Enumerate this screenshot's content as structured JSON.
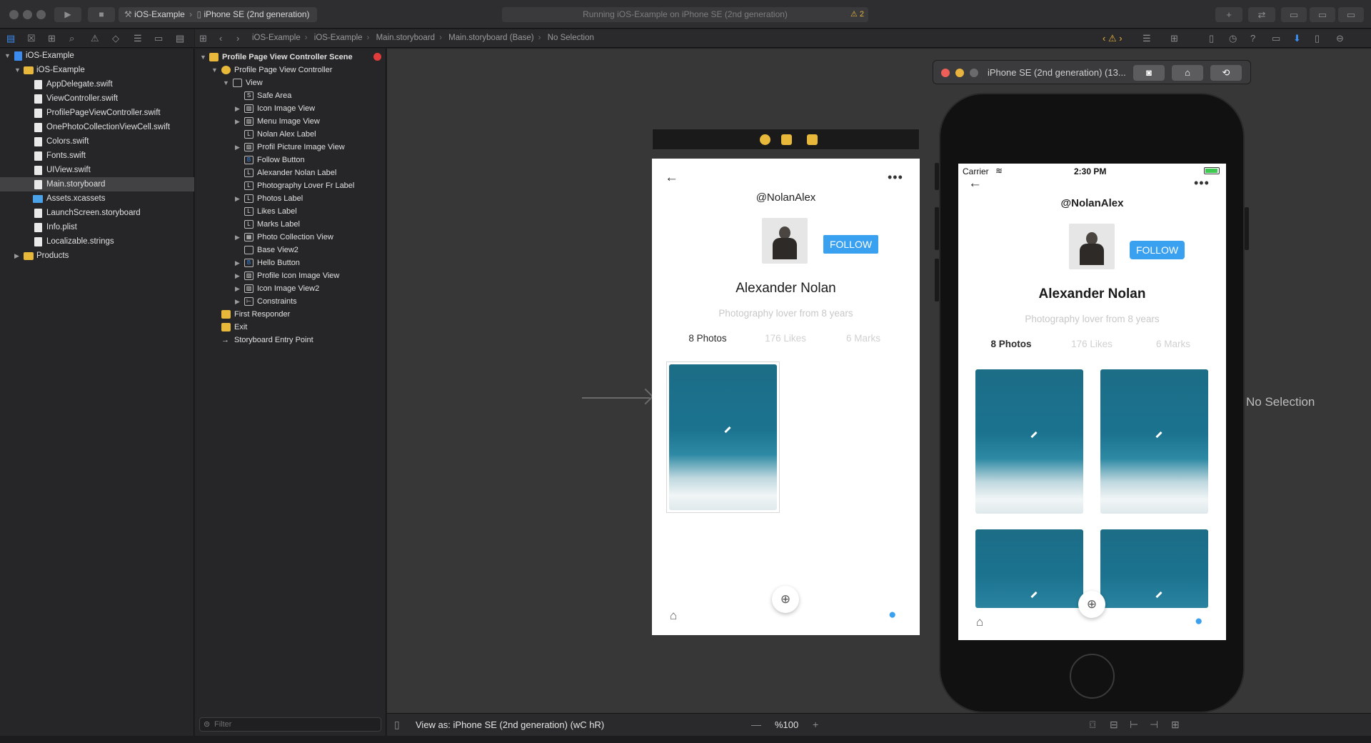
{
  "toolbar": {
    "scheme_target": "iOS-Example",
    "scheme_device": "iPhone SE (2nd generation)",
    "activity_text": "Running iOS-Example on iPhone SE (2nd generation)",
    "warning_count": "2",
    "add_glyph": "+",
    "swap_glyph": "⇄"
  },
  "navigator": {
    "items": [
      {
        "label": "iOS-Example",
        "kind": "project"
      },
      {
        "label": "iOS-Example",
        "kind": "folder"
      },
      {
        "label": "AppDelegate.swift",
        "kind": "file"
      },
      {
        "label": "ViewController.swift",
        "kind": "file"
      },
      {
        "label": "ProfilePageViewController.swift",
        "kind": "file"
      },
      {
        "label": "OnePhotoCollectionViewCell.swift",
        "kind": "file"
      },
      {
        "label": "Colors.swift",
        "kind": "file"
      },
      {
        "label": "Fonts.swift",
        "kind": "file"
      },
      {
        "label": "UIView.swift",
        "kind": "file"
      },
      {
        "label": "Main.storyboard",
        "kind": "file",
        "selected": true
      },
      {
        "label": "Assets.xcassets",
        "kind": "assets"
      },
      {
        "label": "LaunchScreen.storyboard",
        "kind": "file"
      },
      {
        "label": "Info.plist",
        "kind": "file"
      },
      {
        "label": "Localizable.strings",
        "kind": "file"
      },
      {
        "label": "Products",
        "kind": "folder"
      }
    ]
  },
  "jumpbar": {
    "crumbs": [
      "iOS-Example",
      "iOS-Example",
      "Main.storyboard",
      "Main.storyboard (Base)",
      "No Selection"
    ]
  },
  "outline": {
    "items": [
      {
        "label": "Profile Page View Controller Scene",
        "icon": "scene"
      },
      {
        "label": "Profile Page View Controller",
        "icon": "vc"
      },
      {
        "label": "View",
        "icon": "view"
      },
      {
        "label": "Safe Area",
        "icon": "S"
      },
      {
        "label": "Icon Image View",
        "icon": "img"
      },
      {
        "label": "Menu Image View",
        "icon": "img"
      },
      {
        "label": "Nolan Alex Label",
        "icon": "L"
      },
      {
        "label": "Profil Picture Image View",
        "icon": "img"
      },
      {
        "label": "Follow Button",
        "icon": "B"
      },
      {
        "label": "Alexander Nolan Label",
        "icon": "L"
      },
      {
        "label": "Photography Lover Fr Label",
        "icon": "L"
      },
      {
        "label": "Photos Label",
        "icon": "L"
      },
      {
        "label": "Likes Label",
        "icon": "L"
      },
      {
        "label": "Marks Label",
        "icon": "L"
      },
      {
        "label": "Photo Collection View",
        "icon": "grid"
      },
      {
        "label": "Base View2",
        "icon": "view"
      },
      {
        "label": "Hello Button",
        "icon": "B"
      },
      {
        "label": "Profile Icon Image View",
        "icon": "img"
      },
      {
        "label": "Icon Image View2",
        "icon": "img"
      },
      {
        "label": "Constraints",
        "icon": "c"
      },
      {
        "label": "First Responder",
        "icon": "fr"
      },
      {
        "label": "Exit",
        "icon": "exit"
      },
      {
        "label": "Storyboard Entry Point",
        "icon": "arrow"
      }
    ],
    "filter_placeholder": "Filter"
  },
  "profile": {
    "handle": "@NolanAlex",
    "follow_label": "FOLLOW",
    "name": "Alexander Nolan",
    "bio": "Photography lover from 8 years",
    "photos": "8 Photos",
    "likes": "176 Likes",
    "marks": "6 Marks",
    "back_glyph": "←",
    "more_glyph": "•••",
    "add_glyph": "⊕",
    "home_glyph": "⌂"
  },
  "simulator": {
    "title": "iPhone SE (2nd generation) (13...",
    "carrier": "Carrier",
    "time": "2:30 PM"
  },
  "inspector": {
    "no_selection": "No Selection"
  },
  "bottombar": {
    "view_as": "View as: iPhone SE (2nd generation) (wC hR)",
    "zoom": "%100",
    "zoom_out": "—",
    "zoom_in": "+"
  },
  "colors": {
    "accent": "#3c8cf0",
    "follow": "#3aa0f0",
    "warning": "#e6b43c",
    "folder": "#e8b83a"
  }
}
